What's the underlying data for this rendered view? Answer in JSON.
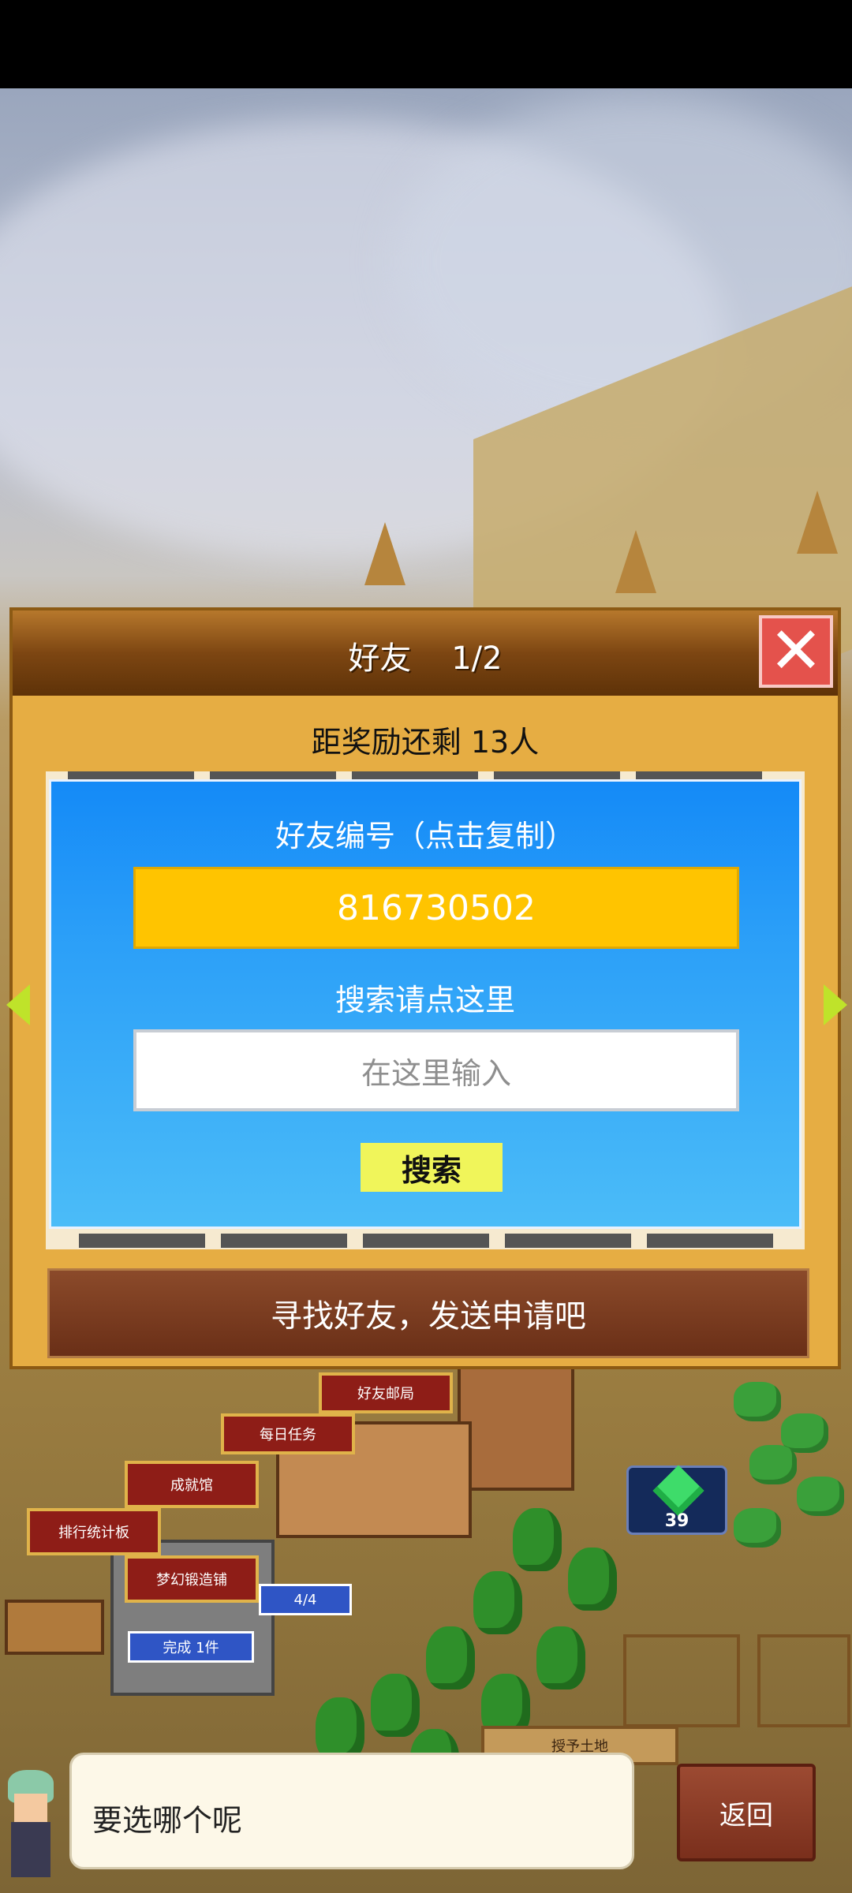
{
  "dialog": {
    "title": "好友    1/2",
    "remaining": "距奖励还剩 13人",
    "friend_id_label": "好友编号（点击复制）",
    "friend_id": "816730502",
    "search_label": "搜索请点这里",
    "search_placeholder": "在这里输入",
    "search_button": "搜索",
    "find_button": "寻找好友，发送申请吧"
  },
  "scene": {
    "signs": [
      "好友邮局",
      "每日任务",
      "成就馆",
      "排行统计板",
      "梦幻锻造铺"
    ],
    "progress": "4/4",
    "complete": "完成 1件",
    "gem_count": "39",
    "plot_label": "授予土地"
  },
  "bottom": {
    "speech": "要选哪个呢",
    "back_button": "返回"
  },
  "colors": {
    "panel_blue": "#148af7",
    "id_box": "#ffc400",
    "search_button": "#f0f55a",
    "close_button": "#e4524c",
    "find_button": "#7a3a20"
  }
}
